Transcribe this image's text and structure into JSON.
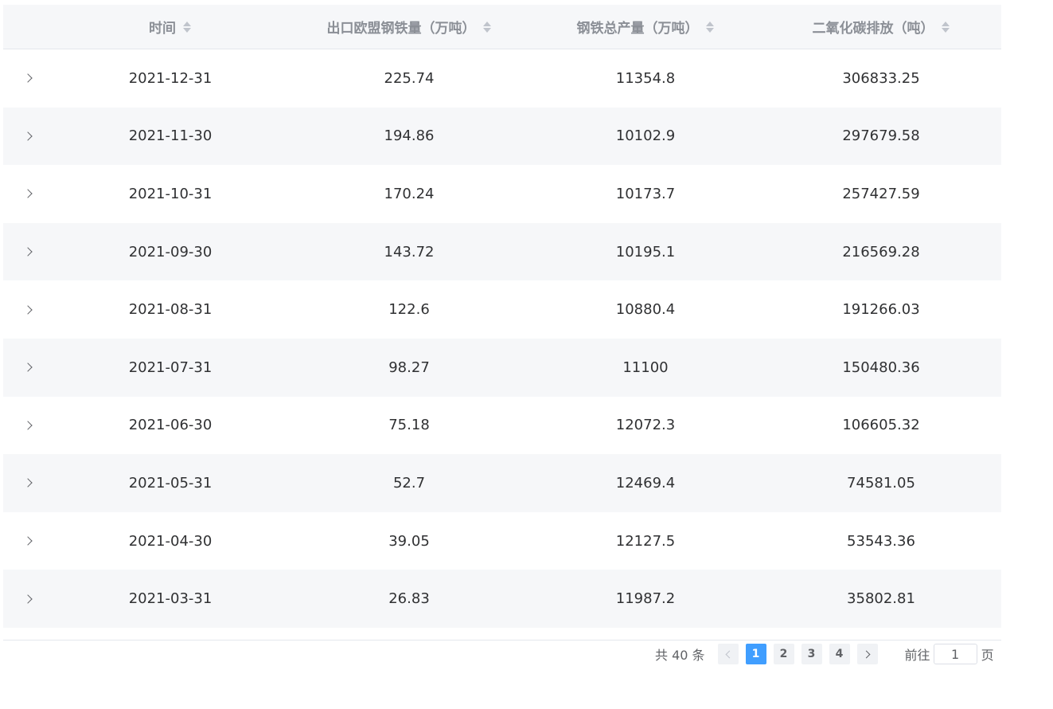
{
  "table": {
    "columns": [
      {
        "label": "时间"
      },
      {
        "label": "出口欧盟钢铁量（万吨）"
      },
      {
        "label": "钢铁总产量（万吨）"
      },
      {
        "label": "二氧化碳排放（吨）"
      }
    ],
    "rows": [
      {
        "date": "2021-12-31",
        "eu_export": "225.74",
        "total_output": "11354.8",
        "co2": "306833.25"
      },
      {
        "date": "2021-11-30",
        "eu_export": "194.86",
        "total_output": "10102.9",
        "co2": "297679.58"
      },
      {
        "date": "2021-10-31",
        "eu_export": "170.24",
        "total_output": "10173.7",
        "co2": "257427.59"
      },
      {
        "date": "2021-09-30",
        "eu_export": "143.72",
        "total_output": "10195.1",
        "co2": "216569.28"
      },
      {
        "date": "2021-08-31",
        "eu_export": "122.6",
        "total_output": "10880.4",
        "co2": "191266.03"
      },
      {
        "date": "2021-07-31",
        "eu_export": "98.27",
        "total_output": "11100",
        "co2": "150480.36"
      },
      {
        "date": "2021-06-30",
        "eu_export": "75.18",
        "total_output": "12072.3",
        "co2": "106605.32"
      },
      {
        "date": "2021-05-31",
        "eu_export": "52.7",
        "total_output": "12469.4",
        "co2": "74581.05"
      },
      {
        "date": "2021-04-30",
        "eu_export": "39.05",
        "total_output": "12127.5",
        "co2": "53543.36"
      },
      {
        "date": "2021-03-31",
        "eu_export": "26.83",
        "total_output": "11987.2",
        "co2": "35802.81"
      }
    ]
  },
  "pagination": {
    "total_text": "共 40 条",
    "pages": [
      "1",
      "2",
      "3",
      "4"
    ],
    "current_page": "1",
    "goto_label": "前往",
    "goto_value": "1",
    "goto_suffix": "页"
  },
  "colors": {
    "header_bg": "#f6f7f9",
    "stripe_bg": "#f6f7f9",
    "active_page": "#409eff"
  },
  "icons": {
    "sort": "sort-caret-icon",
    "expand": "chevron-right-icon",
    "prev": "chevron-left-icon",
    "next": "chevron-right-icon"
  }
}
